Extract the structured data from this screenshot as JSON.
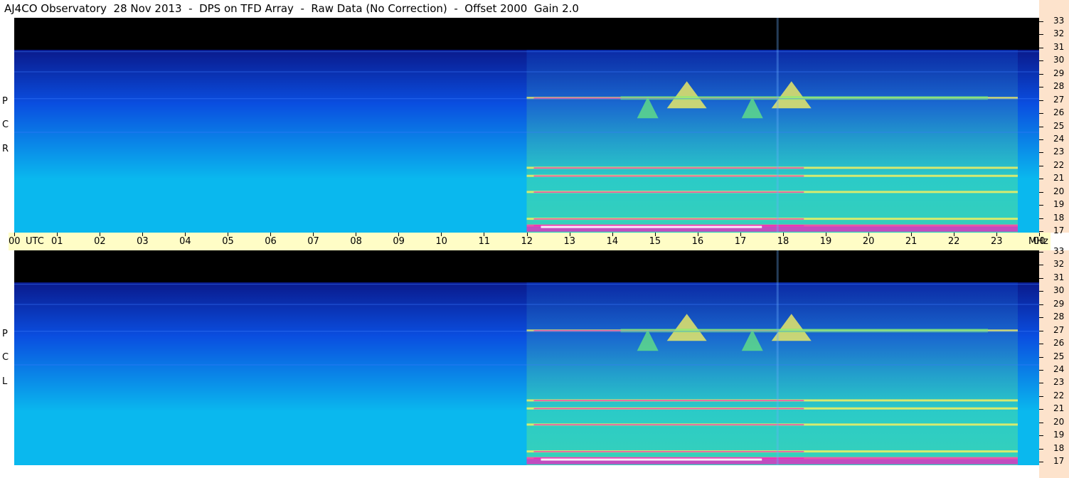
{
  "title": "AJ4CO Observatory  28 Nov 2013  -  DPS on TFD Array  -  Raw Data (No Correction)  -  Offset 2000  Gain 2.0",
  "panels": [
    {
      "label_chars": [
        "P",
        "C",
        "R"
      ]
    },
    {
      "label_chars": [
        "P",
        "C",
        "L"
      ]
    }
  ],
  "time_axis": {
    "labels": [
      "00",
      "UTC",
      "01",
      "02",
      "03",
      "04",
      "05",
      "06",
      "07",
      "08",
      "09",
      "10",
      "11",
      "12",
      "13",
      "14",
      "15",
      "16",
      "17",
      "18",
      "19",
      "20",
      "21",
      "22",
      "23",
      "00",
      "MHz"
    ]
  },
  "freq_axis": {
    "labels": [
      "33",
      "32",
      "31",
      "30",
      "29",
      "28",
      "27",
      "26",
      "25",
      "24",
      "23",
      "22",
      "21",
      "20",
      "19",
      "18",
      "17"
    ]
  },
  "colors": {
    "background_top": "#000000",
    "deep_blue": "#0a1a8c",
    "blue": "#0a4ee0",
    "cyan": "#0ab8ee",
    "green": "#6cf07a",
    "yellow": "#f4f060",
    "magenta": "#f020c0",
    "time_axis_bg": "#fffdc6",
    "freq_axis_bg": "#fde3cc"
  },
  "chart_data": {
    "type": "heatmap",
    "title": "AJ4CO Observatory  28 Nov 2013  -  DPS on TFD Array  -  Raw Data (No Correction)  -  Offset 2000  Gain 2.0",
    "x_unit": "UTC",
    "x_range": [
      0,
      24
    ],
    "y_unit": "MHz",
    "y_range": [
      17,
      33
    ],
    "series": [
      {
        "name": "RCP"
      },
      {
        "name": "LCP"
      }
    ],
    "noise_storm_hours": [
      12,
      23.5
    ],
    "strong_bursts": [
      {
        "hour": 15.75,
        "freq_mhz": 27
      },
      {
        "hour": 18.2,
        "freq_mhz": 27
      }
    ],
    "interference_lines_mhz": [
      17.5,
      18,
      20,
      21.2,
      21.8,
      27
    ]
  }
}
